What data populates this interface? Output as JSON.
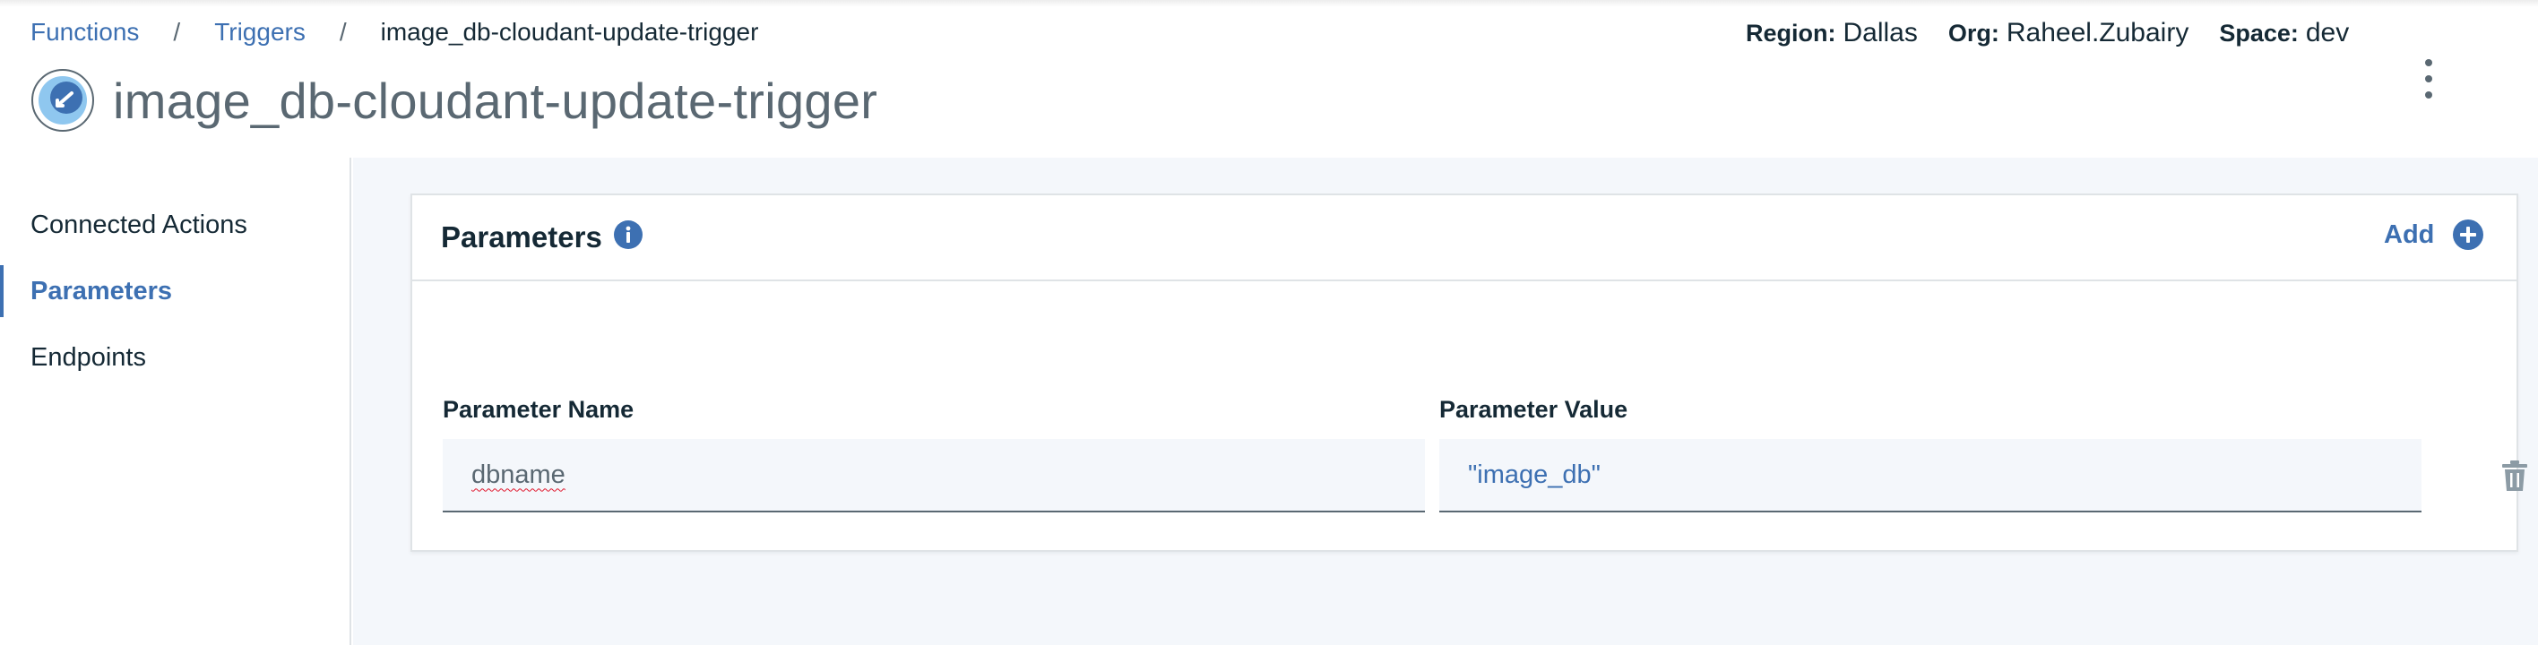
{
  "breadcrumb": {
    "items": [
      "Functions",
      "Triggers"
    ],
    "current": "image_db-cloudant-update-trigger",
    "separator": "/"
  },
  "page": {
    "title": "image_db-cloudant-update-trigger",
    "icon": "trigger-icon"
  },
  "context": {
    "region_label": "Region:",
    "region_value": "Dallas",
    "org_label": "Org:",
    "org_value": "Raheel.Zubairy",
    "space_label": "Space:",
    "space_value": "dev"
  },
  "sidebar": {
    "items": [
      {
        "label": "Connected Actions",
        "active": false
      },
      {
        "label": "Parameters",
        "active": true
      },
      {
        "label": "Endpoints",
        "active": false
      }
    ]
  },
  "parameters": {
    "title": "Parameters",
    "add_label": "Add",
    "name_header": "Parameter Name",
    "value_header": "Parameter Value",
    "rows": [
      {
        "name": "dbname",
        "value": "\"image_db\""
      }
    ]
  },
  "colors": {
    "accent": "#3d70b2",
    "text": "#152935",
    "muted": "#5a6872",
    "background": "#f4f7fb",
    "border": "#dfe3e6"
  },
  "icons": [
    "info-icon",
    "add-icon",
    "delete-icon",
    "overflow-menu-icon",
    "trigger-icon"
  ]
}
